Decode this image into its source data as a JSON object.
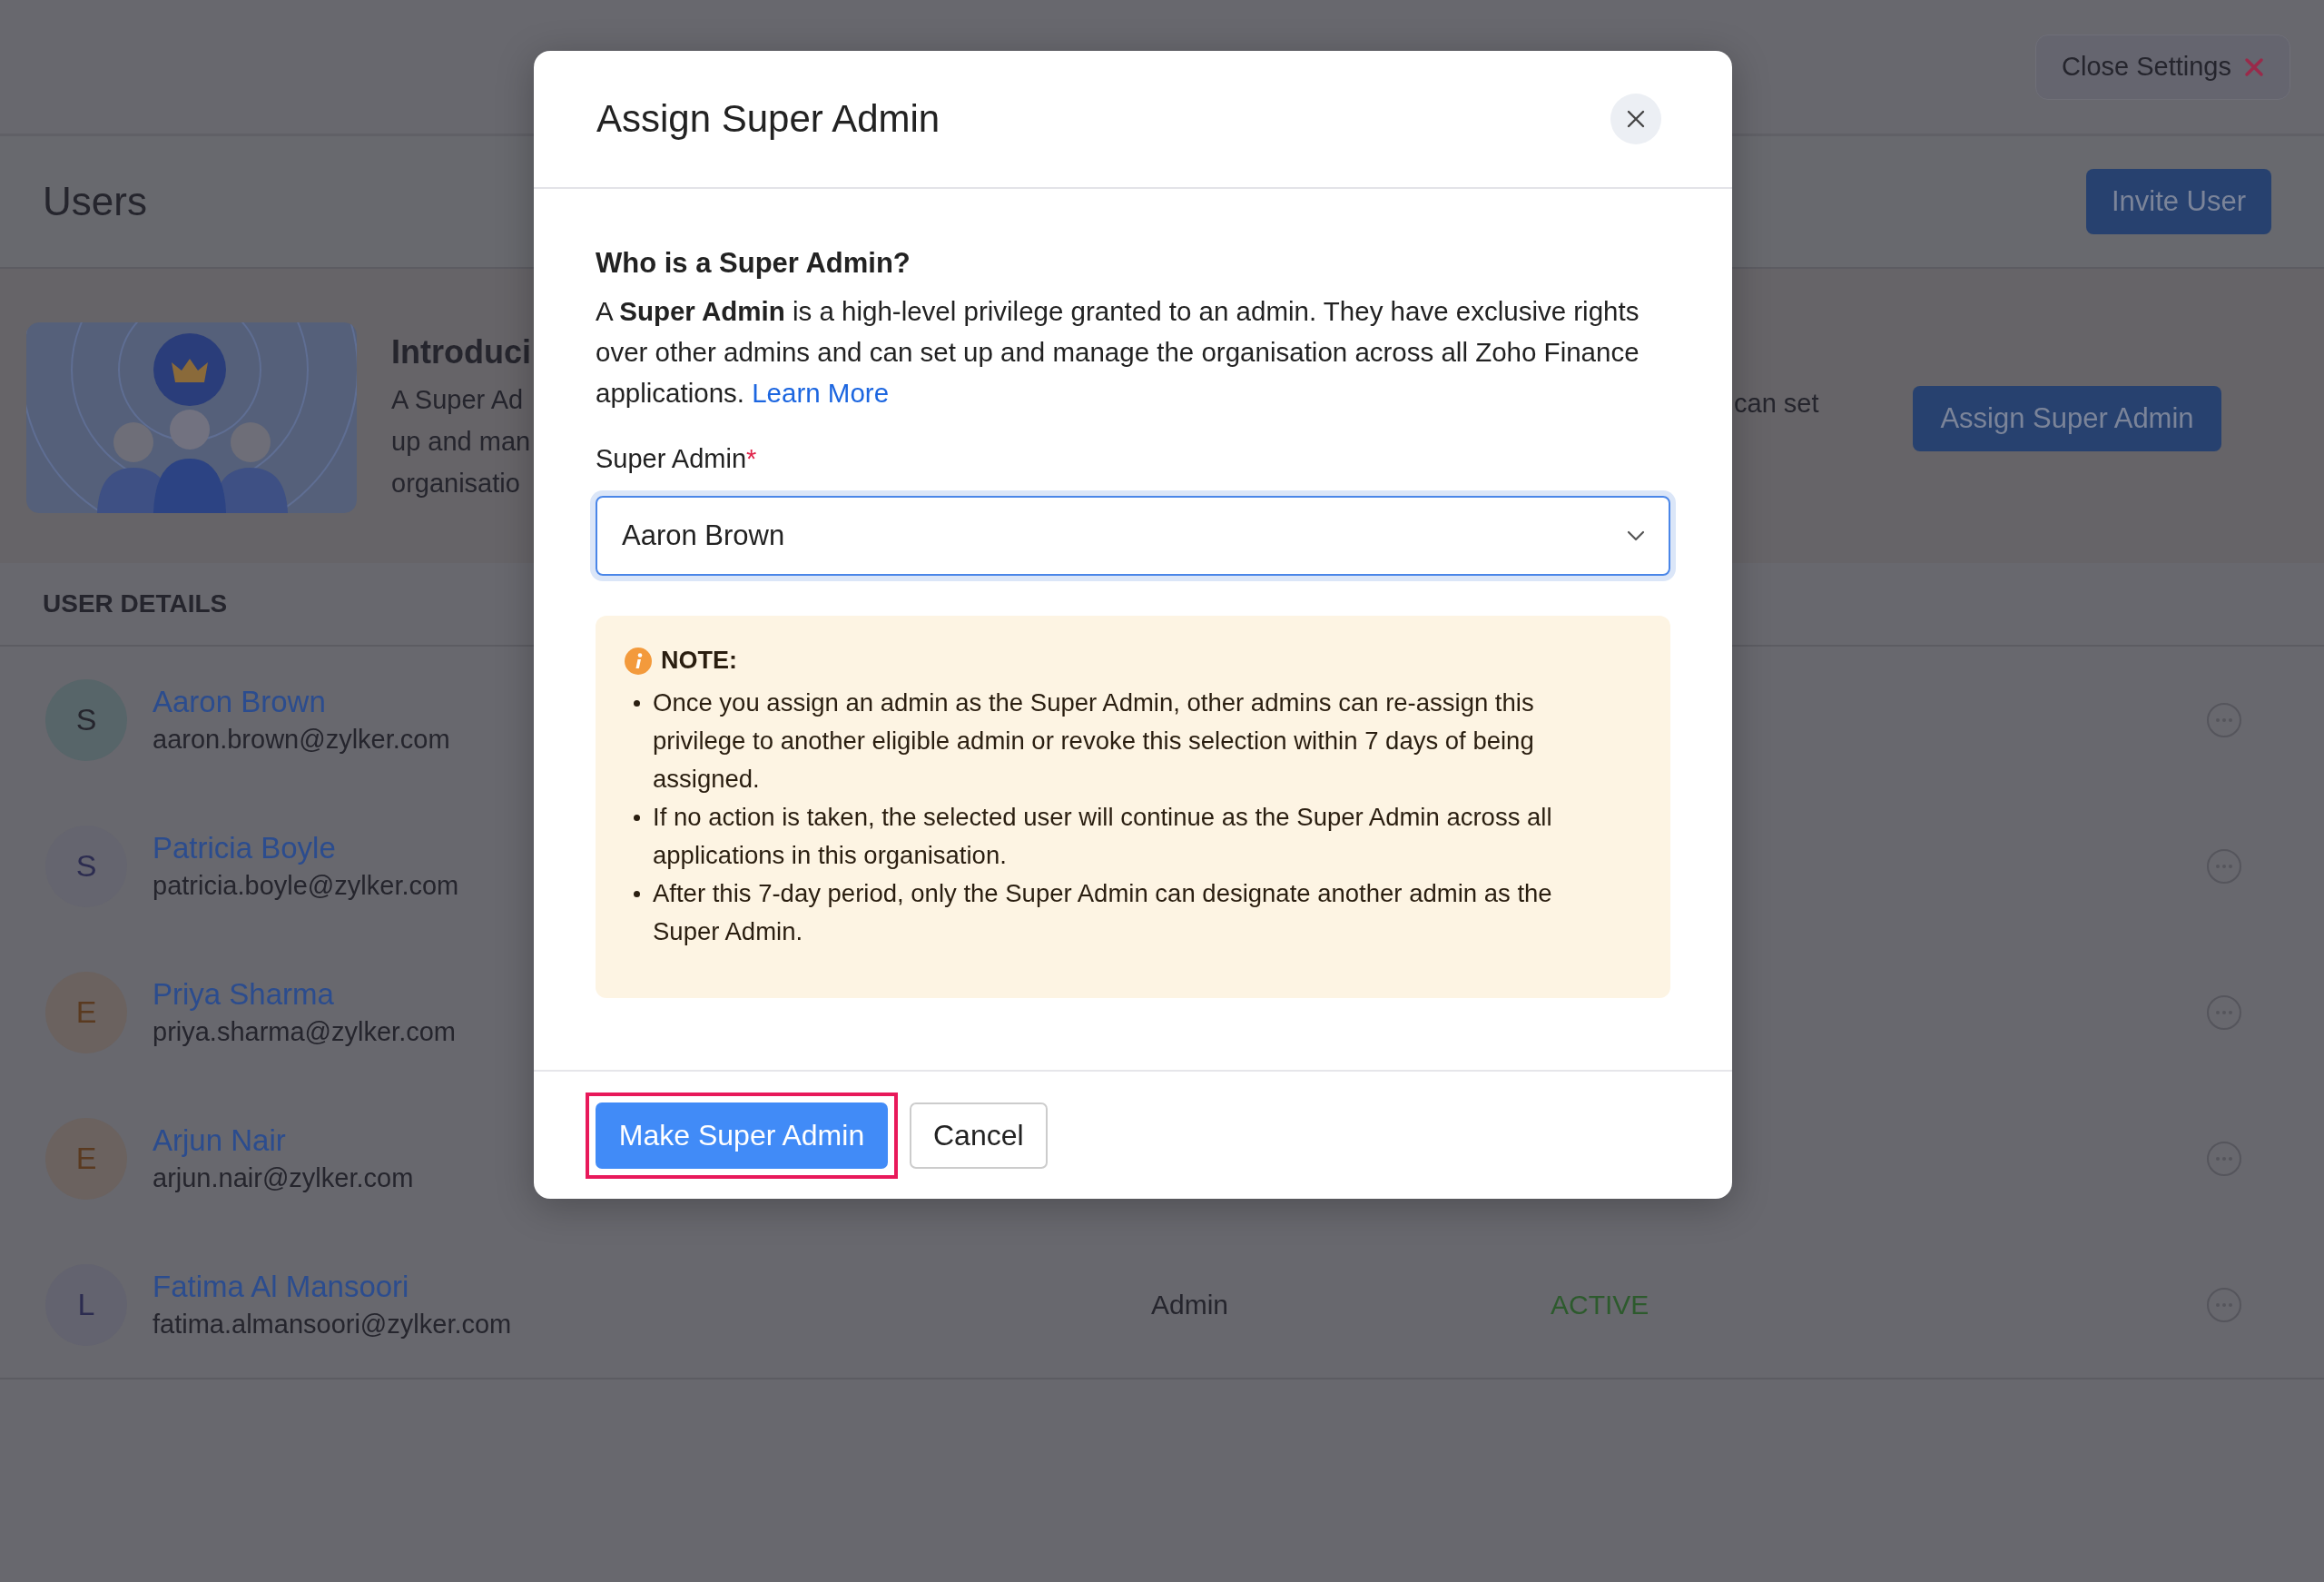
{
  "header": {
    "close_settings": "Close Settings"
  },
  "page": {
    "title": "Users",
    "invite_button": "Invite User"
  },
  "banner": {
    "title": "Introduci",
    "lines": [
      "A Super Ad",
      "up and man",
      "organisatio"
    ],
    "right_text": "can set",
    "button": "Assign Super Admin"
  },
  "section_title": "USER DETAILS",
  "users": [
    {
      "initial": "S",
      "color": "#576569",
      "name": "Aaron Brown",
      "email": "aaron.brown@zylker.com"
    },
    {
      "initial": "S",
      "color": "#65656f",
      "name": "Patricia Boyle",
      "email": "patricia.boyle@zylker.com"
    },
    {
      "initial": "E",
      "color": "#6b625f",
      "name": "Priya Sharma",
      "email": "priya.sharma@zylker.com"
    },
    {
      "initial": "E",
      "color": "#6b625f",
      "name": "Arjun Nair",
      "email": "arjun.nair@zylker.com"
    },
    {
      "initial": "L",
      "color": "#63636f",
      "name": "Fatima Al Mansoori",
      "email": "fatima.almansoori@zylker.com",
      "role": "Admin",
      "status": "ACTIVE"
    }
  ],
  "dialog": {
    "title": "Assign Super Admin",
    "question": "Who is a Super Admin?",
    "description": "A **Super Admin** is a high-level privilege granted to an admin. They have exclusive rights over other admins and can set up and manage the organisation across all Zoho Finance applications.",
    "learn_more": "Learn More",
    "field_label": "Super Admin",
    "required_mark": "*",
    "selected_value": "Aaron Brown",
    "focused": true,
    "note_title": "NOTE:",
    "notes": [
      "Once you assign an admin as the Super Admin, other admins can re-assign this privilege to another eligible admin or revoke this selection within 7 days of being assigned.",
      "If no action is taken, the selected user will continue as the Super Admin across all applications in this organisation.",
      "After this 7-day period, only the Super Admin can designate another admin as the Super Admin."
    ],
    "buttons": [
      {
        "label": "Make Super Admin",
        "kind": "primary",
        "highlighted": true
      },
      {
        "label": "Cancel",
        "kind": "secondary",
        "highlighted": false
      }
    ]
  }
}
